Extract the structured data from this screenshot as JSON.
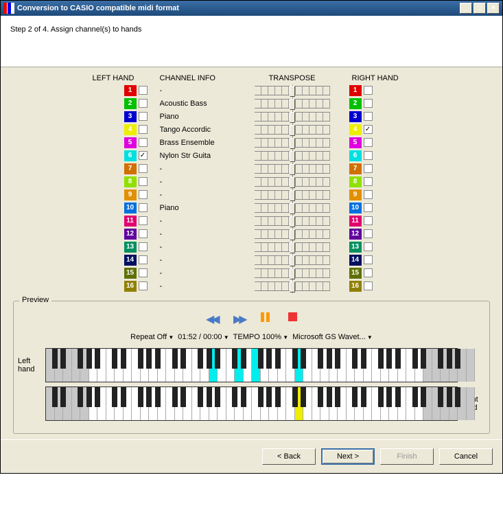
{
  "window": {
    "title": "Conversion to CASIO compatible midi format"
  },
  "step": {
    "text": "Step 2 of 4. Assign channel(s) to hands"
  },
  "columns": {
    "left": "LEFT HAND",
    "info": "CHANNEL INFO",
    "transpose": "TRANSPOSE",
    "right": "RIGHT HAND"
  },
  "channels": [
    {
      "n": 1,
      "color": "#e00000",
      "left": false,
      "right": false,
      "info": "-"
    },
    {
      "n": 2,
      "color": "#00c000",
      "left": false,
      "right": false,
      "info": "Acoustic Bass"
    },
    {
      "n": 3,
      "color": "#0000d0",
      "left": false,
      "right": false,
      "info": "Piano"
    },
    {
      "n": 4,
      "color": "#eeee00",
      "left": false,
      "right": true,
      "info": "Tango Accordic"
    },
    {
      "n": 5,
      "color": "#e000e0",
      "left": false,
      "right": false,
      "info": "Brass Ensemble"
    },
    {
      "n": 6,
      "color": "#00e0e0",
      "left": true,
      "right": false,
      "info": "Nylon Str Guita"
    },
    {
      "n": 7,
      "color": "#d07000",
      "left": false,
      "right": false,
      "info": "-"
    },
    {
      "n": 8,
      "color": "#90e000",
      "left": false,
      "right": false,
      "info": "-"
    },
    {
      "n": 9,
      "color": "#e09000",
      "left": false,
      "right": false,
      "info": "-"
    },
    {
      "n": 10,
      "color": "#0070e0",
      "left": false,
      "right": false,
      "info": "Piano"
    },
    {
      "n": 11,
      "color": "#e00070",
      "left": false,
      "right": false,
      "info": "-"
    },
    {
      "n": 12,
      "color": "#6000a0",
      "left": false,
      "right": false,
      "info": "-"
    },
    {
      "n": 13,
      "color": "#009060",
      "left": false,
      "right": false,
      "info": "-"
    },
    {
      "n": 14,
      "color": "#001060",
      "left": false,
      "right": false,
      "info": "-"
    },
    {
      "n": 15,
      "color": "#607000",
      "left": false,
      "right": false,
      "info": "-"
    },
    {
      "n": 16,
      "color": "#908000",
      "left": false,
      "right": false,
      "info": "-"
    }
  ],
  "preview": {
    "label": "Preview",
    "repeat": "Repeat Off",
    "time": "01:52 / 00:00",
    "tempo": "TEMPO 100%",
    "device": "Microsoft GS Wavet...",
    "leftLabel": "Left hand",
    "rightLabel": "Right hand",
    "leftHighlights": [
      19,
      22,
      24,
      29
    ],
    "rightHighlights": [
      29
    ]
  },
  "buttons": {
    "back": "< Back",
    "next": "Next >",
    "finish": "Finish",
    "cancel": "Cancel"
  }
}
